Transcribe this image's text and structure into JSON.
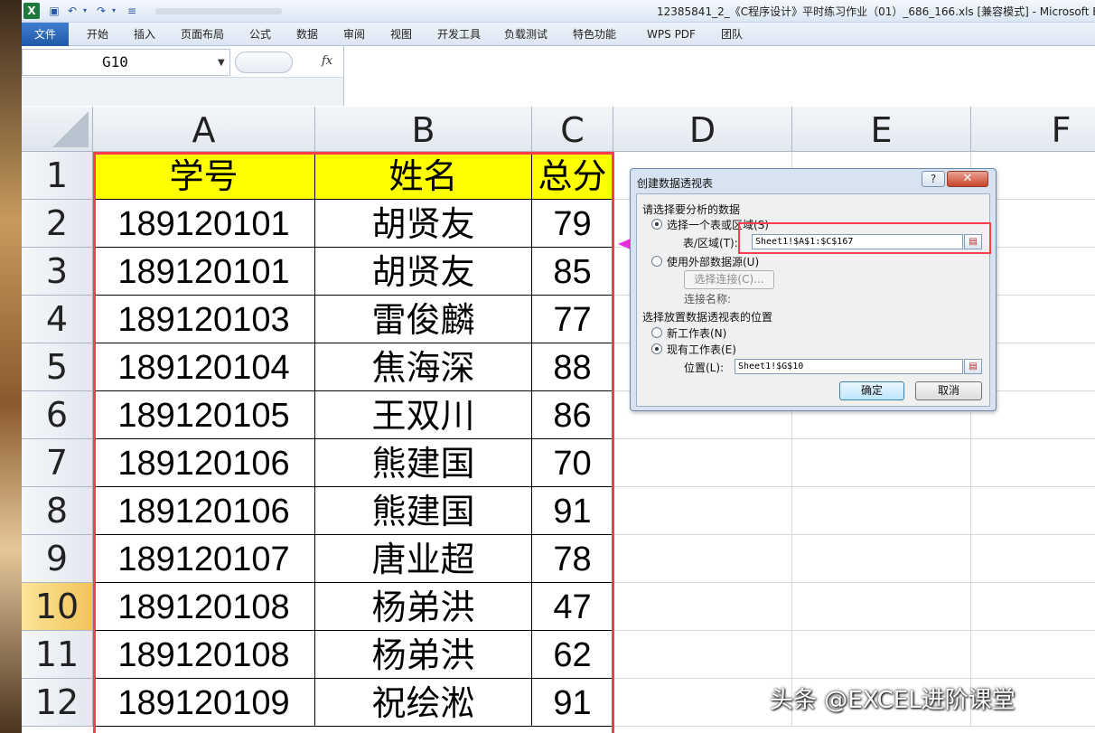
{
  "window": {
    "title": "12385841_2_《C程序设计》平时练习作业（01）_686_166.xls  [兼容模式] - Microsoft E",
    "app_icon": "X"
  },
  "ribbon": {
    "tabs": [
      "文件",
      "开始",
      "插入",
      "页面布局",
      "公式",
      "数据",
      "审阅",
      "视图",
      "开发工具",
      "负载测试",
      "特色功能",
      "WPS PDF",
      "团队"
    ]
  },
  "formula_bar": {
    "name_box": "G10",
    "fx_label": "fx",
    "formula": ""
  },
  "sheet": {
    "columns": [
      "A",
      "B",
      "C",
      "D",
      "E",
      "F"
    ],
    "active_row": "10",
    "headers": {
      "A": "学号",
      "B": "姓名",
      "C": "总分"
    },
    "rows": [
      {
        "row": "1"
      },
      {
        "row": "2",
        "id": "189120101",
        "name": "胡贤友",
        "score": "79"
      },
      {
        "row": "3",
        "id": "189120101",
        "name": "胡贤友",
        "score": "85"
      },
      {
        "row": "4",
        "id": "189120103",
        "name": "雷俊麟",
        "score": "77"
      },
      {
        "row": "5",
        "id": "189120104",
        "name": "焦海深",
        "score": "88"
      },
      {
        "row": "6",
        "id": "189120105",
        "name": "王双川",
        "score": "86"
      },
      {
        "row": "7",
        "id": "189120106",
        "name": "熊建国",
        "score": "70"
      },
      {
        "row": "8",
        "id": "189120106",
        "name": "熊建国",
        "score": "91"
      },
      {
        "row": "9",
        "id": "189120107",
        "name": "唐业超",
        "score": "78"
      },
      {
        "row": "10",
        "id": "189120108",
        "name": "杨弟洪",
        "score": "47"
      },
      {
        "row": "11",
        "id": "189120108",
        "name": "杨弟洪",
        "score": "62"
      },
      {
        "row": "12",
        "id": "189120109",
        "name": "祝绘淞",
        "score": "91"
      }
    ]
  },
  "dialog": {
    "title": "创建数据透视表",
    "help": "?",
    "close": "✕",
    "section1": "请选择要分析的数据",
    "opt_table": "选择一个表或区域(S)",
    "table_range_label": "表/区域(T):",
    "table_range_value": "Sheet1!$A$1:$C$167",
    "opt_external": "使用外部数据源(U)",
    "choose_conn": "选择连接(C)...",
    "conn_name": "连接名称:",
    "section2": "选择放置数据透视表的位置",
    "opt_new_sheet": "新工作表(N)",
    "opt_existing": "现有工作表(E)",
    "location_label": "位置(L):",
    "location_value": "Sheet1!$G$10",
    "ok": "确定",
    "cancel": "取消"
  },
  "watermark": "头条 @EXCEL进阶课堂",
  "colors": {
    "highlight_red": "#ff3b4e",
    "arrow_magenta": "#e830e0",
    "header_yellow": "#ffff00"
  }
}
